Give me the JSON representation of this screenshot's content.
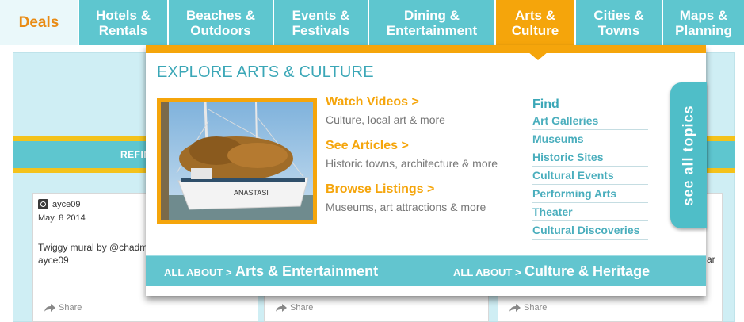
{
  "nav": {
    "tabs": [
      {
        "label": "Deals"
      },
      {
        "label": "Hotels & Rentals"
      },
      {
        "label": "Beaches & Outdoors"
      },
      {
        "label": "Events & Festivals"
      },
      {
        "label": "Dining & Entertainment"
      },
      {
        "label": "Arts & Culture"
      },
      {
        "label": "Cities & Towns"
      },
      {
        "label": "Maps & Planning"
      }
    ],
    "active": "Arts & Culture"
  },
  "background": {
    "refine_label": "REFIN",
    "cards": [
      {
        "handle": "ayce09",
        "date": "May, 8 2014",
        "caption_line1": "Twiggy mural by @chadm",
        "caption_line2": "ayce09",
        "share": "Share"
      },
      {
        "share": "Share"
      },
      {
        "share": "Share"
      }
    ],
    "right_fragment": "ar"
  },
  "dropdown": {
    "heading": "EXPLORE ARTS & CULTURE",
    "photo_caption": "ANASTASI",
    "features": [
      {
        "title": "Watch Videos >",
        "subtitle": "Culture, local art & more"
      },
      {
        "title": "See Articles >",
        "subtitle": "Historic towns, architecture & more"
      },
      {
        "title": "Browse Listings >",
        "subtitle": "Museums, art attractions & more"
      }
    ],
    "find": {
      "heading": "Find",
      "links": [
        "Art Galleries",
        "Museums",
        "Historic Sites",
        "Cultural Events",
        "Performing Arts",
        "Theater",
        "Cultural Discoveries"
      ]
    },
    "see_all": "see all topics",
    "all_about": [
      {
        "prefix": "ALL ABOUT >",
        "label": "Arts & Entertainment"
      },
      {
        "prefix": "ALL ABOUT >",
        "label": "Culture & Heritage"
      }
    ]
  },
  "colors": {
    "accent_orange": "#f5a50b",
    "teal": "#5ec6cf",
    "heading_teal": "#3ba7b7"
  }
}
